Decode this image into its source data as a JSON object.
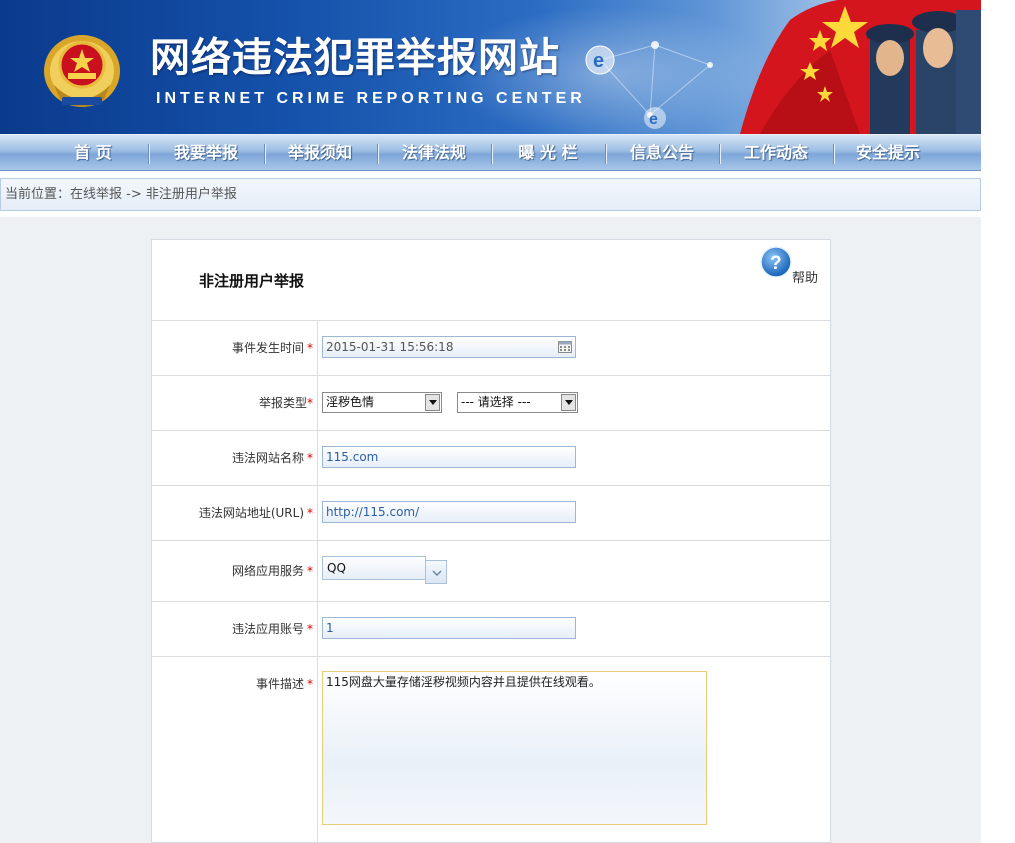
{
  "site": {
    "title": "网络违法犯罪举报网站",
    "subtitle": "INTERNET  CRIME  REPORTING  CENTER",
    "brand_color": "#1552ab"
  },
  "nav": {
    "items": [
      {
        "label": "首  页"
      },
      {
        "label": "我要举报"
      },
      {
        "label": "举报须知"
      },
      {
        "label": "法律法规"
      },
      {
        "label": "曝 光 栏"
      },
      {
        "label": "信息公告"
      },
      {
        "label": "工作动态"
      },
      {
        "label": "安全提示"
      }
    ]
  },
  "breadcrumb": {
    "text": "当前位置：在线举报 -> 非注册用户举报"
  },
  "form": {
    "heading": "非注册用户举报",
    "help_label": "帮助",
    "help_icon": "question-icon",
    "required_mark": "*",
    "fields": {
      "event_time": {
        "label": "事件发生时间",
        "value": "2015-01-31 15:56:18",
        "icon": "calendar-icon"
      },
      "report_type": {
        "label": "举报类型",
        "selected": "淫秽色情",
        "sub_selected": "--- 请选择 ---"
      },
      "site_name": {
        "label": "违法网站名称",
        "value": "115.com"
      },
      "site_url": {
        "label": "违法网站地址(URL)",
        "value": "http://115.com/"
      },
      "app_service": {
        "label": "网络应用服务",
        "selected": "QQ"
      },
      "app_account": {
        "label": "违法应用账号",
        "value": "1"
      },
      "description": {
        "label": "事件描述",
        "value": "115网盘大量存储淫秽视频内容并且提供在线观看。"
      }
    }
  }
}
